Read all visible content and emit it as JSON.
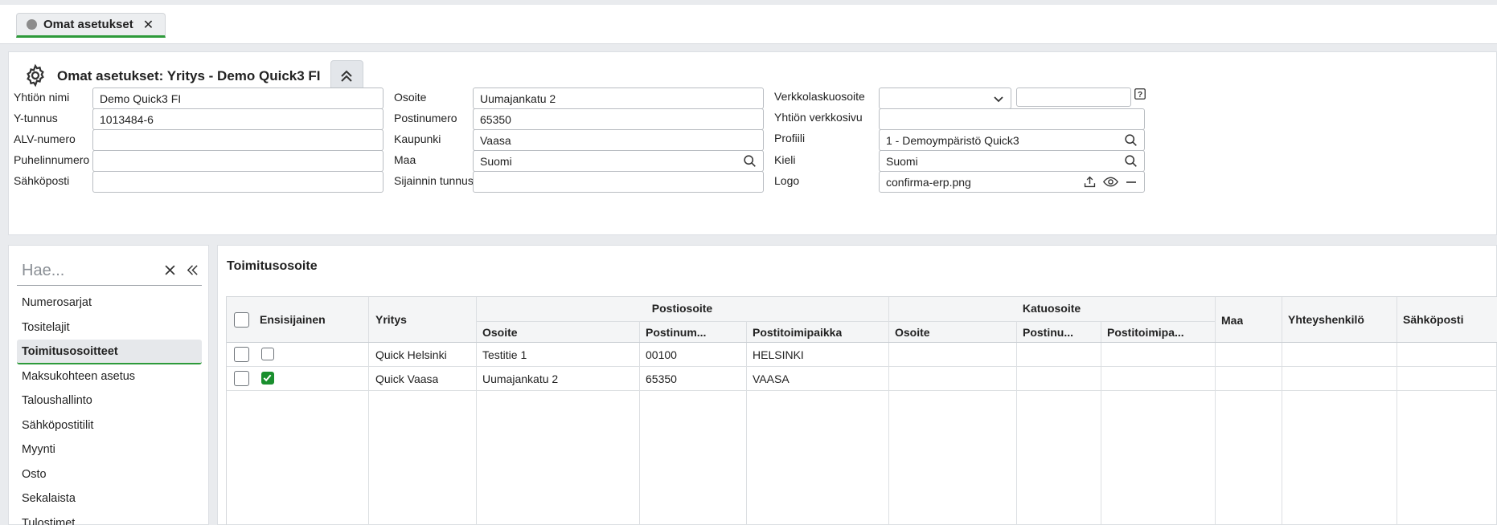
{
  "tabs": [
    {
      "label": "Omat asetukset"
    }
  ],
  "header": {
    "title": "Omat asetukset: Yritys - Demo Quick3 FI"
  },
  "form": {
    "company_name": {
      "label": "Yhtiön nimi",
      "value": "Demo Quick3 FI"
    },
    "business_id": {
      "label": "Y-tunnus",
      "value": "1013484-6"
    },
    "vat_number": {
      "label": "ALV-numero",
      "value": ""
    },
    "phone": {
      "label": "Puhelinnumero",
      "value": ""
    },
    "email": {
      "label": "Sähköposti",
      "value": ""
    },
    "address": {
      "label": "Osoite",
      "value": "Uumajankatu 2"
    },
    "postal_code": {
      "label": "Postinumero",
      "value": "65350"
    },
    "city": {
      "label": "Kaupunki",
      "value": "Vaasa"
    },
    "country": {
      "label": "Maa",
      "value": "Suomi"
    },
    "location_id": {
      "label": "Sijainnin tunnus",
      "value": ""
    },
    "e_invoice_address": {
      "label": "Verkkolaskuosoite",
      "value": "",
      "extra_value": ""
    },
    "website": {
      "label": "Yhtiön verkkosivu",
      "value": ""
    },
    "profile": {
      "label": "Profiili",
      "value": "1 - Demoympäristö Quick3"
    },
    "language": {
      "label": "Kieli",
      "value": "Suomi"
    },
    "logo": {
      "label": "Logo",
      "value": "confirma-erp.png"
    }
  },
  "sidebar": {
    "search_placeholder": "Hae...",
    "items": [
      {
        "label": "Numerosarjat"
      },
      {
        "label": "Tositelajit"
      },
      {
        "label": "Toimitusosoitteet",
        "active": true
      },
      {
        "label": "Maksukohteen asetus"
      },
      {
        "label": "Taloushallinto"
      },
      {
        "label": "Sähköpostitilit"
      },
      {
        "label": "Myynti"
      },
      {
        "label": "Osto"
      },
      {
        "label": "Sekalaista"
      },
      {
        "label": "Tulostimet"
      }
    ]
  },
  "main": {
    "title": "Toimitusosoite",
    "table": {
      "group_headers": {
        "postal": "Postiosoite",
        "street": "Katuosoite"
      },
      "columns": {
        "primary": "Ensisijainen",
        "company": "Yritys",
        "p_address": "Osoite",
        "p_postal_code": "Postinum...",
        "p_city": "Postitoimipaikka",
        "s_address": "Osoite",
        "s_postal_code": "Postinu...",
        "s_city": "Postitoimipa...",
        "country": "Maa",
        "contact": "Yhteyshenkilö",
        "email": "Sähköposti"
      },
      "rows": [
        {
          "primary": false,
          "company": "Quick Helsinki",
          "p_address": "Testitie 1",
          "p_postal_code": "00100",
          "p_city": "HELSINKI",
          "s_address": "",
          "s_postal_code": "",
          "s_city": "",
          "country": "",
          "contact": "",
          "email": ""
        },
        {
          "primary": true,
          "company": "Quick Vaasa",
          "p_address": "Uumajankatu 2",
          "p_postal_code": "65350",
          "p_city": "VAASA",
          "s_address": "",
          "s_postal_code": "",
          "s_city": "",
          "country": "",
          "contact": "",
          "email": ""
        }
      ]
    }
  },
  "colors": {
    "accent": "#2d9a3a",
    "checked": "#1a8f2e"
  },
  "icons": [
    "gear-icon",
    "chevrons-up-icon",
    "close-icon",
    "chevron-down-icon",
    "help-icon",
    "search-icon",
    "upload-icon",
    "eye-icon",
    "minus-icon",
    "double-chevron-left-icon"
  ]
}
